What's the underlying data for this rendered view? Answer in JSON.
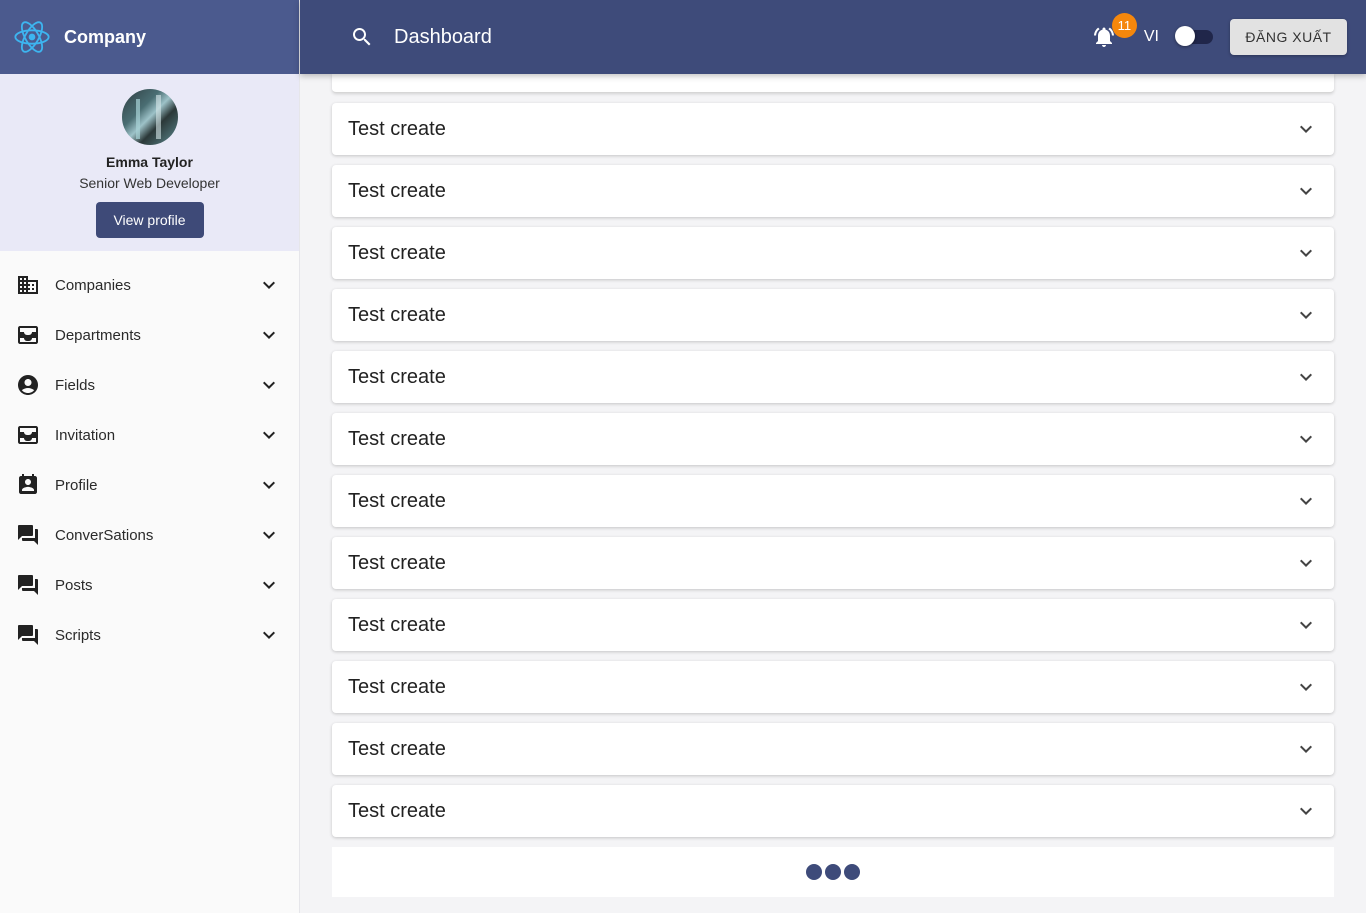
{
  "brand": {
    "name": "Company"
  },
  "user": {
    "name": "Emma Taylor",
    "role": "Senior Web Developer",
    "view_profile_label": "View profile"
  },
  "sidebar": {
    "items": [
      {
        "label": "Companies",
        "icon": "domain-icon"
      },
      {
        "label": "Departments",
        "icon": "inbox-icon"
      },
      {
        "label": "Fields",
        "icon": "account-circle-icon"
      },
      {
        "label": "Invitation",
        "icon": "inbox-icon"
      },
      {
        "label": "Profile",
        "icon": "contact-icon"
      },
      {
        "label": "ConverSations",
        "icon": "forum-icon"
      },
      {
        "label": "Posts",
        "icon": "forum-icon"
      },
      {
        "label": "Scripts",
        "icon": "forum-icon"
      }
    ]
  },
  "header": {
    "title": "Dashboard",
    "notification_count": "11",
    "language": "VI",
    "logout_label": "ĐĂNG XUẤT"
  },
  "main": {
    "rows": [
      {
        "title": "Test create"
      },
      {
        "title": "Test create"
      },
      {
        "title": "Test create"
      },
      {
        "title": "Test create"
      },
      {
        "title": "Test create"
      },
      {
        "title": "Test create"
      },
      {
        "title": "Test create"
      },
      {
        "title": "Test create"
      },
      {
        "title": "Test create"
      },
      {
        "title": "Test create"
      },
      {
        "title": "Test create"
      },
      {
        "title": "Test create"
      }
    ]
  },
  "colors": {
    "primary": "#3e4b7a",
    "brand_bar": "#4b5a8e",
    "user_panel": "#e9e9f7",
    "badge": "#f5870c",
    "logo": "#3db5f0"
  }
}
